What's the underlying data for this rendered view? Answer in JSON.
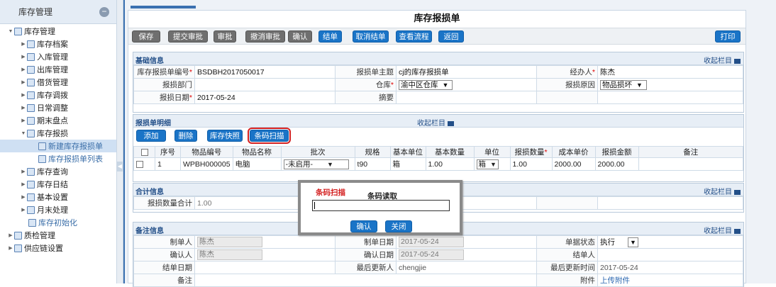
{
  "sidebar": {
    "title": "库存管理",
    "collapse_icon": "minus-circle-icon",
    "root": "库存管理",
    "items": [
      "库存档案",
      "入库管理",
      "出库管理",
      "借货管理",
      "库存调拨",
      "日常调整",
      "期末盘点",
      "库存报损"
    ],
    "sub_items": [
      "新建库存报损单",
      "库存报损单列表"
    ],
    "items2": [
      "库存查询",
      "库存日结",
      "基本设置",
      "月末处理"
    ],
    "leaf": "库存初始化",
    "top_items": [
      "质检管理",
      "供应链设置"
    ]
  },
  "page": {
    "title": "库存报损单"
  },
  "toolbar": {
    "save": "保存",
    "submit": "提交审批",
    "approve": "审批",
    "cancel_approve": "撤消审批",
    "confirm": "确认",
    "finish": "结单",
    "cancel_finish": "取消结单",
    "flow": "查看流程",
    "back": "返回",
    "print": "打印"
  },
  "basic": {
    "header": "基础信息",
    "collapse": "收起栏目",
    "no_label": "库存报损单编号",
    "no_value": "BSDBH2017050017",
    "subject_label": "报损单主题",
    "subject_value": "cj的库存报损单",
    "handler_label": "经办人",
    "handler_value": "陈杰",
    "dept_label": "报损部门",
    "dept_value": "",
    "warehouse_label": "仓库",
    "warehouse_value": "渝中区仓库",
    "reason_label": "报损原因",
    "reason_value": "物品损坏",
    "date_label": "报损日期",
    "date_value": "2017-05-24",
    "summary_label": "摘要",
    "summary_value": ""
  },
  "detail": {
    "header": "报损单明细",
    "collapse": "收起栏目",
    "btn_add": "添加",
    "btn_delete": "删除",
    "btn_snapshot": "库存快照",
    "btn_barcode": "条码扫描",
    "columns": [
      "序号",
      "物品编号",
      "物品名称",
      "批次",
      "规格",
      "基本单位",
      "基本数量",
      "单位",
      "报损数量",
      "成本单价",
      "报损金额",
      "备注"
    ],
    "rows": [
      {
        "seq": "1",
        "code": "WPBH000005",
        "name": "电脑",
        "batch": "-未启用-",
        "spec": "t90",
        "base_unit": "箱",
        "base_qty": "1.00",
        "unit": "箱",
        "loss_qty": "1.00",
        "unit_cost": "2000.00",
        "amount": "2000.00",
        "remark": ""
      }
    ]
  },
  "total": {
    "header": "合计信息",
    "collapse": "收起栏目",
    "qty_label": "报损数量合计",
    "qty_value": "1.00"
  },
  "remark": {
    "header": "备注信息",
    "collapse": "收起栏目",
    "maker_label": "制单人",
    "maker_value": "陈杰",
    "make_date_label": "制单日期",
    "make_date_value": "2017-05-24",
    "status_label": "单据状态",
    "status_value": "执行",
    "confirmer_label": "确认人",
    "confirmer_value": "陈杰",
    "confirm_date_label": "确认日期",
    "confirm_date_value": "2017-05-24",
    "finisher_label": "结单人",
    "finisher_value": "",
    "finish_date_label": "结单日期",
    "finish_date_value": "",
    "updater_label": "最后更新人",
    "updater_value": "chengjie",
    "update_time_label": "最后更新时间",
    "update_time_value": "2017-05-24",
    "note_label": "备注",
    "attach_label": "附件",
    "attach_link": "上传附件"
  },
  "dialog": {
    "title": "条码扫描",
    "subtitle": "条码读取",
    "input_value": "",
    "ok": "确认",
    "close": "关闭"
  }
}
